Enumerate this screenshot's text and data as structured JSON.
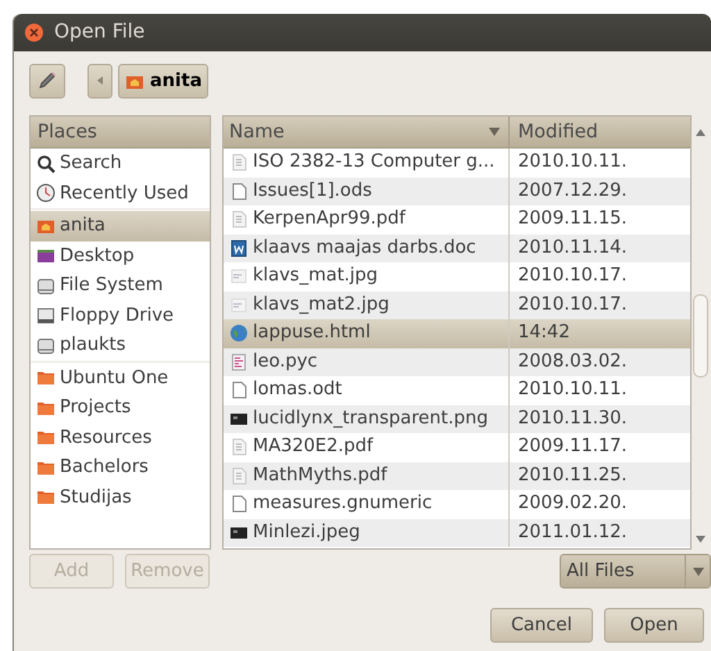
{
  "window": {
    "title": "Open File"
  },
  "path_bar": {
    "current": "anita"
  },
  "places": {
    "header": "Places",
    "groups": [
      [
        {
          "label": "Search",
          "kind": "search",
          "selected": false
        },
        {
          "label": "Recently Used",
          "kind": "recent",
          "selected": false
        }
      ],
      [
        {
          "label": "anita",
          "kind": "home",
          "selected": true
        },
        {
          "label": "Desktop",
          "kind": "desktop",
          "selected": false
        },
        {
          "label": "File System",
          "kind": "drive",
          "selected": false
        },
        {
          "label": "Floppy Drive",
          "kind": "floppy",
          "selected": false
        },
        {
          "label": "plaukts",
          "kind": "drive",
          "selected": false
        }
      ],
      [
        {
          "label": "Ubuntu One",
          "kind": "folder",
          "selected": false
        },
        {
          "label": "Projects",
          "kind": "folder",
          "selected": false
        },
        {
          "label": "Resources",
          "kind": "folder",
          "selected": false
        },
        {
          "label": "Bachelors",
          "kind": "folder",
          "selected": false
        },
        {
          "label": "Studijas",
          "kind": "folder",
          "selected": false
        }
      ]
    ]
  },
  "files": {
    "columns": [
      "Name",
      "Modified"
    ],
    "rows": [
      {
        "name": "ISO 2382-13 Computer g...",
        "modified": "2010.10.11.",
        "kind": "pdf",
        "selected": false
      },
      {
        "name": "Issues[1].ods",
        "modified": "2007.12.29.",
        "kind": "doc",
        "selected": false
      },
      {
        "name": "KerpenApr99.pdf",
        "modified": "2009.11.15.",
        "kind": "pdf",
        "selected": false
      },
      {
        "name": "klaavs maajas darbs.doc",
        "modified": "2010.11.14.",
        "kind": "word",
        "selected": false
      },
      {
        "name": "klavs_mat.jpg",
        "modified": "2010.10.17.",
        "kind": "image",
        "selected": false
      },
      {
        "name": "klavs_mat2.jpg",
        "modified": "2010.10.17.",
        "kind": "image",
        "selected": false
      },
      {
        "name": "lappuse.html",
        "modified": "14:42",
        "kind": "globe",
        "selected": true
      },
      {
        "name": "leo.pyc",
        "modified": "2008.03.02.",
        "kind": "code",
        "selected": false
      },
      {
        "name": "lomas.odt",
        "modified": "2010.10.11.",
        "kind": "doc",
        "selected": false
      },
      {
        "name": "lucidlynx_transparent.png",
        "modified": "2010.11.30.",
        "kind": "dark",
        "selected": false
      },
      {
        "name": "MA320E2.pdf",
        "modified": "2009.11.17.",
        "kind": "pdf",
        "selected": false
      },
      {
        "name": "MathMyths.pdf",
        "modified": "2010.11.25.",
        "kind": "pdf",
        "selected": false
      },
      {
        "name": "measures.gnumeric",
        "modified": "2009.02.20.",
        "kind": "doc",
        "selected": false
      },
      {
        "name": "Minlezi.jpeg",
        "modified": "2011.01.12.",
        "kind": "dark",
        "selected": false
      }
    ]
  },
  "place_buttons": [
    {
      "label": "Add",
      "disabled": true
    },
    {
      "label": "Remove",
      "disabled": true
    }
  ],
  "filter": {
    "value": "All Files"
  },
  "buttons": [
    "Cancel",
    "Open"
  ]
}
